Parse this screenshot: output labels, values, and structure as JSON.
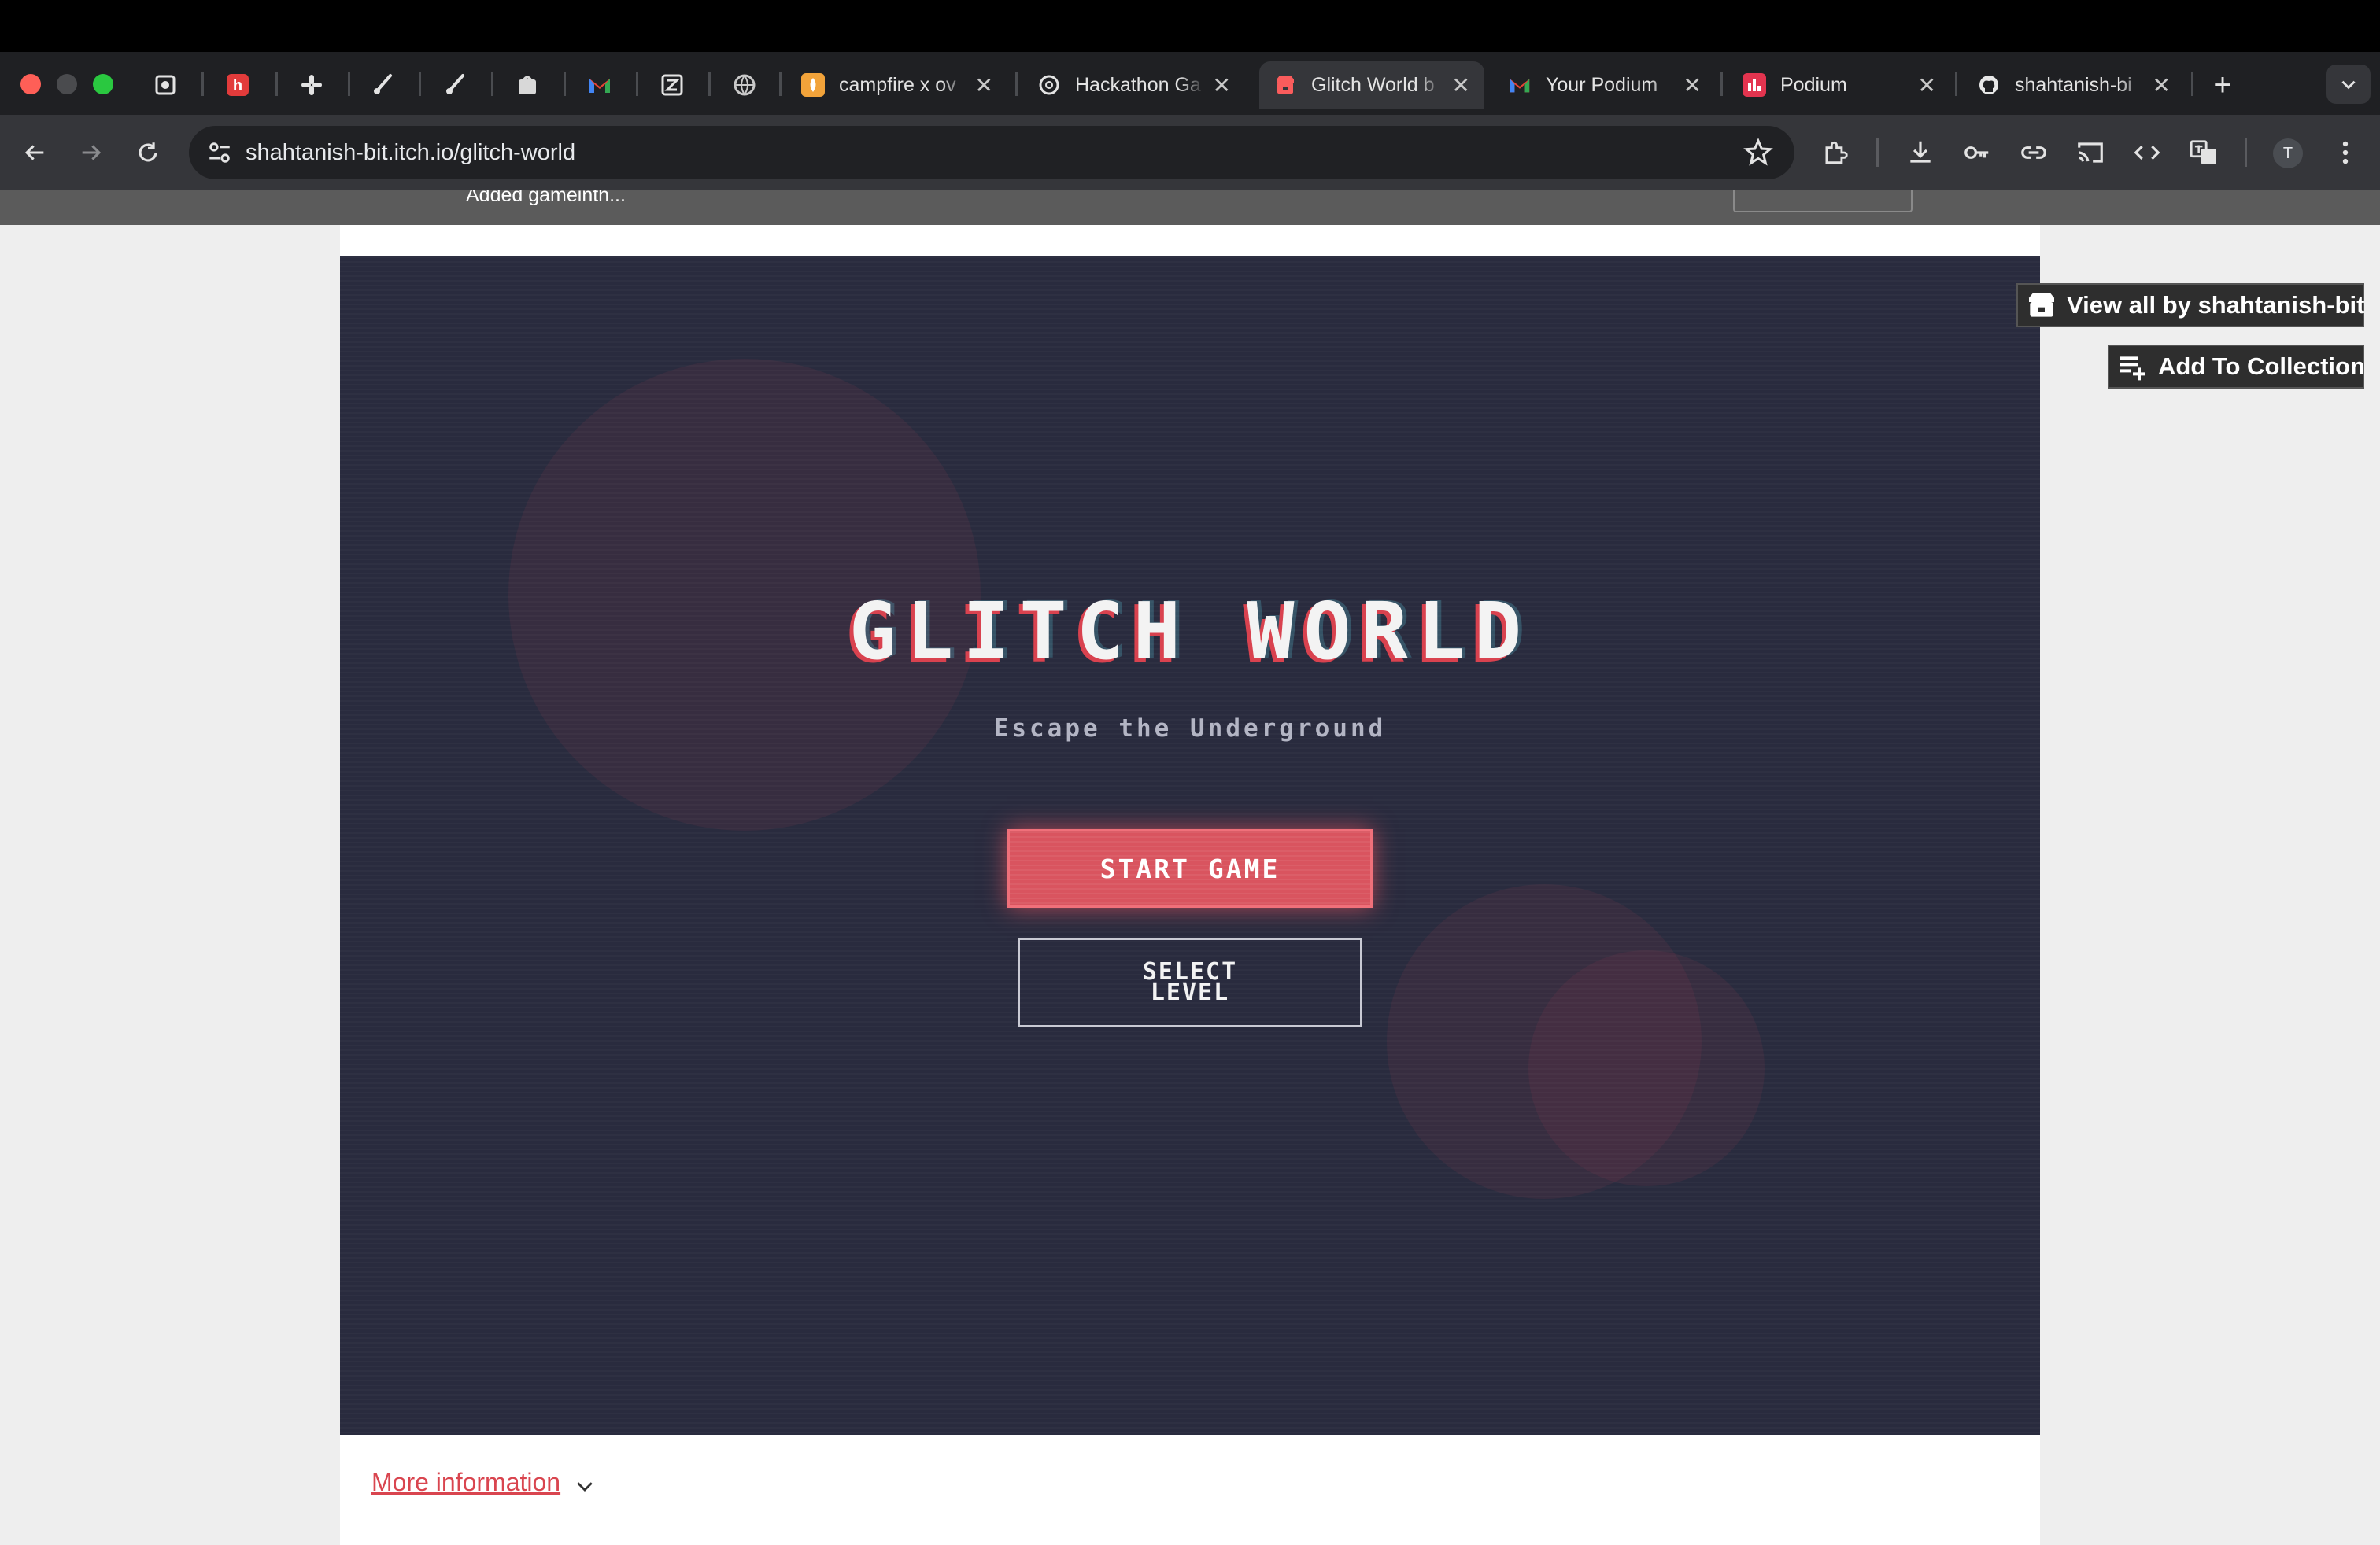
{
  "browser": {
    "tabs": [
      {
        "title": "campfire x ov",
        "favicon": "campfire-icon",
        "color": "#f2a33a"
      },
      {
        "title": "Hackathon Ga",
        "favicon": "openai-icon",
        "color": "#ffffff"
      },
      {
        "title": "Glitch World b",
        "favicon": "itchio-icon",
        "color": "#fa5c5c",
        "active": true
      },
      {
        "title": "Your Podium",
        "favicon": "gmail-icon",
        "color": "#ea4335"
      },
      {
        "title": "Podium",
        "favicon": "podium-icon",
        "color": "#e3344f"
      },
      {
        "title": "shahtanish-bi",
        "favicon": "github-icon",
        "color": "#ffffff"
      }
    ],
    "tab_close": "✕",
    "new_tab": "+",
    "url": "shahtanish-bit.itch.io/glitch-world",
    "profile_initial": "T"
  },
  "devbar": {
    "note": "Added gameinth..."
  },
  "game": {
    "title": "GLITCH WORLD",
    "subtitle": "Escape the Underground",
    "start_label": "START GAME",
    "select_label": "SELECT LEVEL"
  },
  "page": {
    "more_info": "More information",
    "view_all": "View all by shahtanish-bit",
    "add_collection": "Add To Collection"
  },
  "colors": {
    "accent": "#d9454f",
    "game_bg": "#292b3e",
    "start_button": "#d9545f"
  }
}
